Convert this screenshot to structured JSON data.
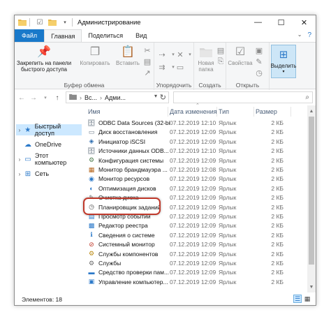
{
  "window": {
    "title": "Администрирование",
    "quick_access": {
      "properties_icon": "checkmark-icon",
      "folder_icon": "folder-icon",
      "dropdown_icon": "chevron-down-icon"
    },
    "controls": {
      "minimize": "—",
      "maximize": "☐",
      "close": "✕"
    }
  },
  "ribbon": {
    "tabs": [
      "Файл",
      "Главная",
      "Поделиться",
      "Вид"
    ],
    "groups": {
      "clipboard": {
        "label": "Буфер обмена",
        "pin": "Закрепить на панели быстрого доступа",
        "copy": "Копировать",
        "paste": "Вставить"
      },
      "organize": {
        "label": "Упорядочить"
      },
      "create": {
        "label": "Создать",
        "new_folder": "Новая папка"
      },
      "open": {
        "label": "Открыть",
        "properties": "Свойства"
      },
      "select": {
        "select": "Выделить"
      }
    }
  },
  "address": {
    "path": [
      "Вс...",
      "Адми..."
    ],
    "search_placeholder": ""
  },
  "navigation": [
    {
      "label": "Быстрый доступ",
      "icon": "star-icon",
      "expanded": true
    },
    {
      "label": "OneDrive",
      "icon": "cloud-icon"
    },
    {
      "label": "Этот компьютер",
      "icon": "computer-icon"
    },
    {
      "label": "Сеть",
      "icon": "network-icon"
    }
  ],
  "columns": {
    "name": "Имя",
    "date": "Дата изменения",
    "type": "Тип",
    "size": "Размер"
  },
  "files": [
    {
      "name": "ODBC Data Sources (32-bit)",
      "date": "07.12.2019 12:10",
      "type": "Ярлык",
      "size": "2 КБ",
      "icon": "odbc-icon"
    },
    {
      "name": "Диск восстановления",
      "date": "07.12.2019 12:09",
      "type": "Ярлык",
      "size": "2 КБ",
      "icon": "recovery-drive-icon"
    },
    {
      "name": "Инициатор iSCSI",
      "date": "07.12.2019 12:09",
      "type": "Ярлык",
      "size": "2 КБ",
      "icon": "iscsi-icon"
    },
    {
      "name": "Источники данных ODB...",
      "date": "07.12.2019 12:10",
      "type": "Ярлык",
      "size": "2 КБ",
      "icon": "odbc-icon"
    },
    {
      "name": "Конфигурация системы",
      "date": "07.12.2019 12:09",
      "type": "Ярлык",
      "size": "2 КБ",
      "icon": "system-config-icon"
    },
    {
      "name": "Монитор брандмауэра ...",
      "date": "07.12.2019 12:08",
      "type": "Ярлык",
      "size": "2 КБ",
      "icon": "firewall-icon"
    },
    {
      "name": "Монитор ресурсов",
      "date": "07.12.2019 12:09",
      "type": "Ярлык",
      "size": "2 КБ",
      "icon": "resource-monitor-icon"
    },
    {
      "name": "Оптимизация дисков",
      "date": "07.12.2019 12:09",
      "type": "Ярлык",
      "size": "2 КБ",
      "icon": "defrag-icon"
    },
    {
      "name": "Очистка диска",
      "date": "07.12.2019 12:09",
      "type": "Ярлык",
      "size": "2 КБ",
      "icon": "disk-cleanup-icon"
    },
    {
      "name": "Планировщик заданий",
      "date": "07.12.2019 12:09",
      "type": "Ярлык",
      "size": "2 КБ",
      "icon": "task-scheduler-icon",
      "highlighted": true
    },
    {
      "name": "Просмотр событий",
      "date": "07.12.2019 12:09",
      "type": "Ярлык",
      "size": "2 КБ",
      "icon": "event-viewer-icon"
    },
    {
      "name": "Редактор реестра",
      "date": "07.12.2019 12:09",
      "type": "Ярлык",
      "size": "2 КБ",
      "icon": "registry-editor-icon"
    },
    {
      "name": "Сведения о системе",
      "date": "07.12.2019 12:09",
      "type": "Ярлык",
      "size": "2 КБ",
      "icon": "system-info-icon"
    },
    {
      "name": "Системный монитор",
      "date": "07.12.2019 12:09",
      "type": "Ярлык",
      "size": "2 КБ",
      "icon": "performance-monitor-icon"
    },
    {
      "name": "Службы компонентов",
      "date": "07.12.2019 12:09",
      "type": "Ярлык",
      "size": "2 КБ",
      "icon": "component-services-icon"
    },
    {
      "name": "Службы",
      "date": "07.12.2019 12:09",
      "type": "Ярлык",
      "size": "2 КБ",
      "icon": "services-icon"
    },
    {
      "name": "Средство проверки пам...",
      "date": "07.12.2019 12:09",
      "type": "Ярлык",
      "size": "2 КБ",
      "icon": "memory-diagnostic-icon"
    },
    {
      "name": "Управление компьютер...",
      "date": "07.12.2019 12:09",
      "type": "Ярлык",
      "size": "2 КБ",
      "icon": "computer-management-icon"
    }
  ],
  "status": {
    "count": "Элементов: 18"
  },
  "colors": {
    "accent": "#1979ca",
    "selection": "#cce8ff",
    "highlight_ring": "#c0392b"
  }
}
